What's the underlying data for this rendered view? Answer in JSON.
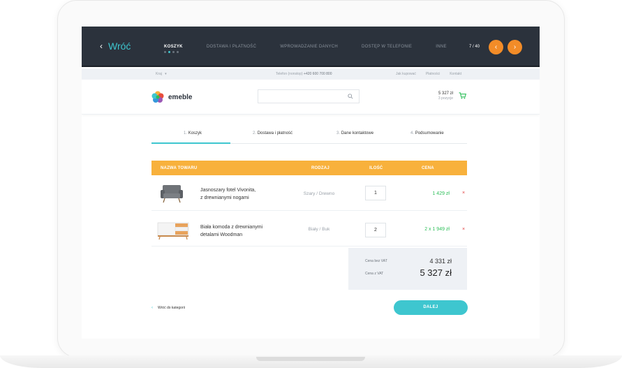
{
  "preview": {
    "back_label": "Wróć",
    "nav": [
      "KOSZYK",
      "DOSTAWA I PŁATNOŚĆ",
      "WPROWADZANIE DANYCH",
      "DOSTĘP W TELEFONIE",
      "INNE"
    ],
    "pager": "7 / 40"
  },
  "utility": {
    "country": "Kraj",
    "phone_label": "Telefon (nonstop)",
    "phone_number": "+420 600 700 800",
    "links": [
      "Jak kupować",
      "Płatności",
      "Kontakt"
    ]
  },
  "header": {
    "brand": "emeble",
    "search": {
      "placeholder": ""
    },
    "cart_total": "5 327 zł",
    "cart_count": "3 pozycje"
  },
  "steps": [
    {
      "num": "1.",
      "label": "Koszyk"
    },
    {
      "num": "2.",
      "label": "Dostawa i płatność"
    },
    {
      "num": "3.",
      "label": "Dane kontaktowe"
    },
    {
      "num": "4.",
      "label": "Podsumowanie"
    }
  ],
  "table": {
    "headers": {
      "name": "NAZWA TOWARU",
      "variant": "RODZAJ",
      "qty": "ILOŚĆ",
      "price": "CENA"
    },
    "rows": [
      {
        "name_line1": "Jasnoszary fotel Vivonita,",
        "name_line2": "z drewnianymi nogami",
        "variant": "Szary / Drewno",
        "qty": "1",
        "price": "1 429 zł",
        "remove": "×"
      },
      {
        "name_line1": "Biała komoda z drewnianymi",
        "name_line2": "detalami Woodman",
        "variant": "Biały / Buk",
        "qty": "2",
        "price": "2 x  1 949 zł",
        "remove": "×"
      }
    ]
  },
  "summary": {
    "net_label": "Cena bez VAT",
    "net_value": "4 331 zł",
    "gross_label": "Cena z VAT",
    "gross_value": "5 327 zł"
  },
  "footer": {
    "back_link": "Wróć do kategorii",
    "next_label": "DALEJ"
  },
  "colors": {
    "accent": "#3ec6cf",
    "orange": "#f28c28",
    "table_head": "#f8b13c",
    "dark": "#2b323c",
    "price_green": "#2ebf5a"
  }
}
